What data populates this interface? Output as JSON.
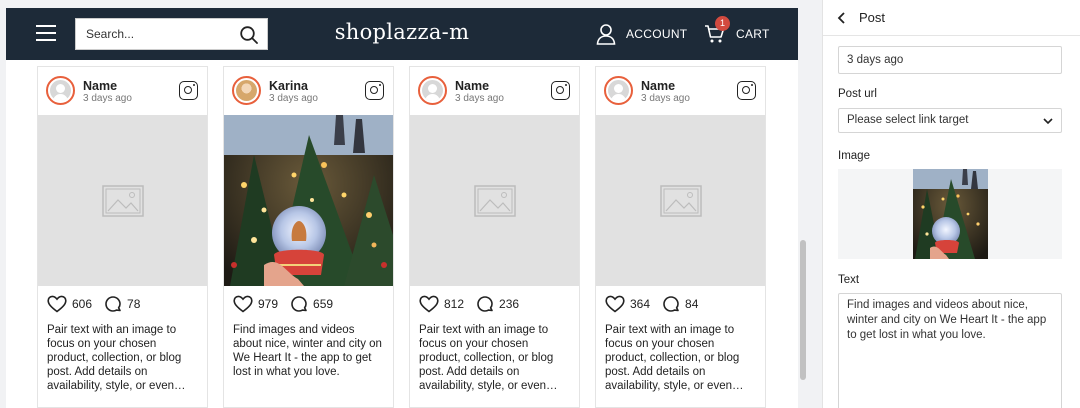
{
  "header": {
    "search_placeholder": "Search...",
    "logo": "shoplazza-m",
    "account_label": "ACCOUNT",
    "cart_label": "CART",
    "cart_count": "1"
  },
  "posts": [
    {
      "name": "Name",
      "time": "3 days ago",
      "likes": "606",
      "comments": "78",
      "text": "Pair text with an image to focus on your chosen product, collection, or blog post. Add details on availability, style, or even…",
      "image": "placeholder"
    },
    {
      "name": "Karina",
      "time": "3 days ago",
      "likes": "979",
      "comments": "659",
      "text": "Find images and videos about nice, winter and city on We Heart It - the app to get lost in what you love.",
      "image": "christmas-tree-snowglobe"
    },
    {
      "name": "Name",
      "time": "3 days ago",
      "likes": "812",
      "comments": "236",
      "text": "Pair text with an image to focus on your chosen product, collection, or blog post. Add details on availability, style, or even…",
      "image": "placeholder"
    },
    {
      "name": "Name",
      "time": "3 days ago",
      "likes": "364",
      "comments": "84",
      "text": "Pair text with an image to focus on your chosen product, collection, or blog post. Add details on availability, style, or even…",
      "image": "placeholder"
    }
  ],
  "panel": {
    "title": "Post",
    "date_value": "3 days ago",
    "post_url_label": "Post url",
    "post_url_value": "Please select link target",
    "image_label": "Image",
    "text_label": "Text",
    "text_value": "Find images and videos about nice, winter and city on We Heart It - the app to get lost in what you love."
  },
  "colors": {
    "header_bg": "#1d2a38",
    "avatar_ring": "#e8603c",
    "cart_badge": "#d24a3f"
  }
}
